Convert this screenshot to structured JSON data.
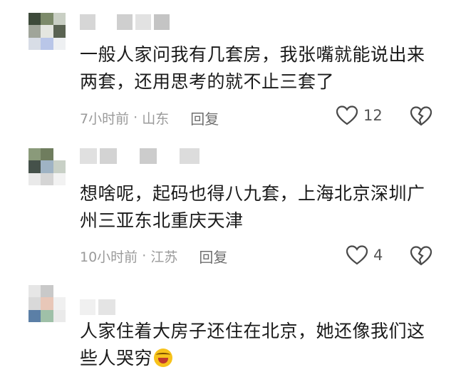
{
  "comments": [
    {
      "text": "一般人家问我有几套房，我张嘴就能说出来两套，还用思考的就不止三套了",
      "time": "7小时前",
      "location": "山东",
      "reply_label": "回复",
      "likes": "12",
      "icons": {
        "like": "heart-outline-icon",
        "dislike": "broken-heart-icon"
      }
    },
    {
      "text": "想啥呢，起码也得八九套，上海北京深圳广州三亚东北重庆天津",
      "time": "10小时前",
      "location": "江苏",
      "reply_label": "回复",
      "likes": "4",
      "icons": {
        "like": "heart-outline-icon",
        "dislike": "broken-heart-icon"
      }
    },
    {
      "text": "人家住着大房子还住在北京，她还像我们这些人哭穷",
      "emoji": "laughing-crying-emoji"
    }
  ]
}
